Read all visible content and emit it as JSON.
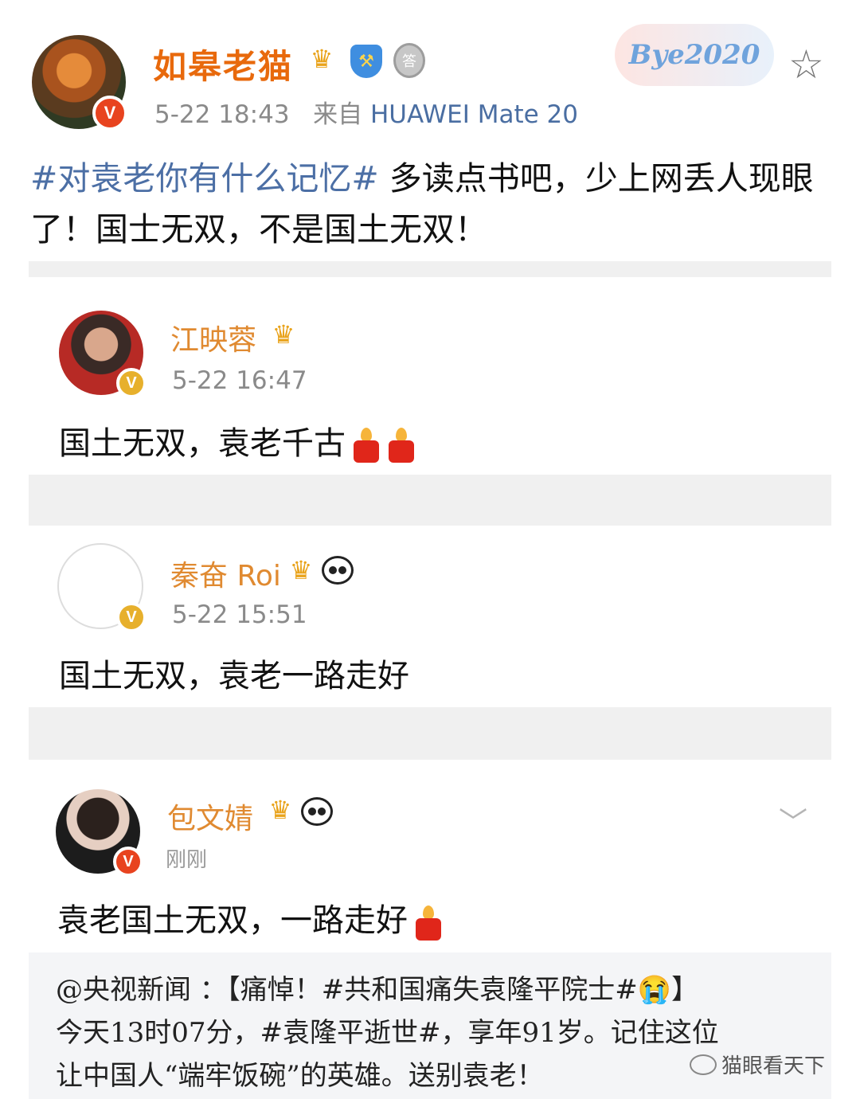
{
  "main_post": {
    "author": "如皋老猫",
    "time": "5-22 18:43",
    "source_prefix": "来自",
    "source": "HUAWEI Mate 20",
    "hashtag": "#对袁老你有什么记忆#",
    "text": " 多读点书吧，少上网丢人现眼了！国士无双，不是国土无双！",
    "badge_text": "Bye2020",
    "icons": [
      "crown-icon",
      "shield-hammer-icon",
      "medal-icon",
      "star-icon"
    ]
  },
  "comments": [
    {
      "name": "江映蓉",
      "time": "5-22 16:47",
      "text": "国土无双，袁老千古"
    },
    {
      "name": "秦奋 Roi",
      "time": "5-22 15:51",
      "text": "国土无双，袁老一路走好"
    },
    {
      "name": "包文婧",
      "time": "刚刚",
      "text": "袁老国土无双，一路走好"
    }
  ],
  "repost": {
    "line1": "@央视新闻 ：【痛悼！#共和国痛失袁隆平院士#😭】",
    "line2": "今天13时07分，#袁隆平逝世#，享年91岁。记住这位",
    "line3": "让中国人“端牢饭碗”的英雄。送别袁老！"
  },
  "watermark": "猫眼看天下",
  "colors": {
    "name_orange": "#e8690c",
    "hashtag_blue": "#4c6fa5",
    "vip_gold": "#e2a100"
  }
}
